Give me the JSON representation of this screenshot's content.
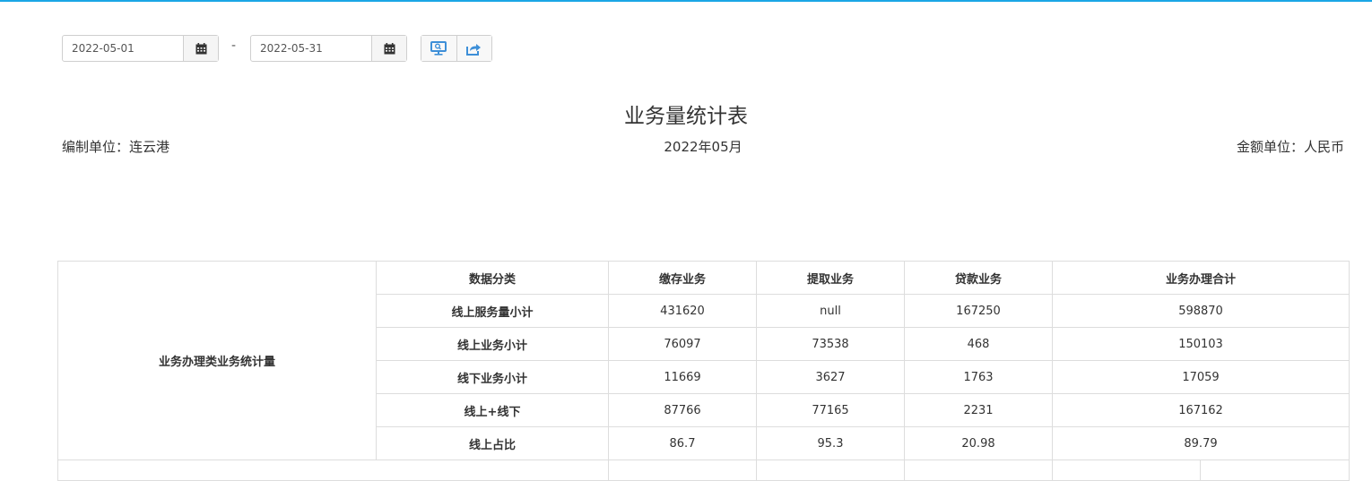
{
  "toolbar": {
    "start_date": "2022-05-01",
    "end_date": "2022-05-31",
    "separator": "-"
  },
  "report": {
    "title": "业务量统计表",
    "unit_label": "编制单位：连云港",
    "period": "2022年05月",
    "currency_label": "金额单位：人民币"
  },
  "table": {
    "group_label": "业务办理类业务统计量",
    "headers": [
      "数据分类",
      "缴存业务",
      "提取业务",
      "贷款业务",
      "业务办理合计"
    ],
    "rows": [
      {
        "label": "线上服务量小计",
        "values": [
          "431620",
          "null",
          "167250",
          "598870"
        ]
      },
      {
        "label": "线上业务小计",
        "values": [
          "76097",
          "73538",
          "468",
          "150103"
        ]
      },
      {
        "label": "线下业务小计",
        "values": [
          "11669",
          "3627",
          "1763",
          "17059"
        ]
      },
      {
        "label": "线上+线下",
        "values": [
          "87766",
          "77165",
          "2231",
          "167162"
        ]
      },
      {
        "label": "线上占比",
        "values": [
          "86.7",
          "95.3",
          "20.98",
          "89.79"
        ]
      }
    ]
  },
  "colors": {
    "accent": "#1aa6e6",
    "icon_blue": "#3d8fd8",
    "border": "#dddddd"
  },
  "icons": [
    "calendar-icon",
    "monitor-icon",
    "export-icon"
  ]
}
